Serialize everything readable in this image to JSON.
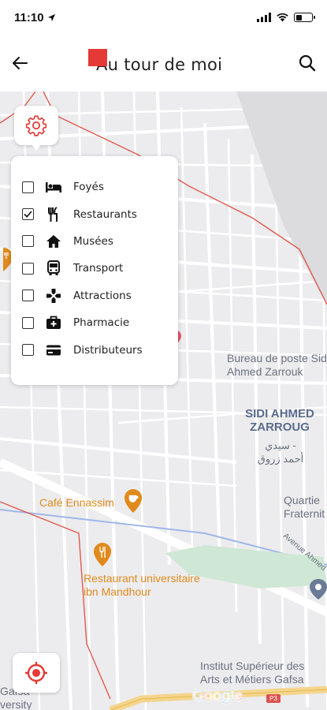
{
  "status_bar": {
    "time": "11:10",
    "icons": [
      "location-arrow-icon",
      "cellular-signal-icon",
      "wifi-icon",
      "battery-icon"
    ]
  },
  "header": {
    "title": "Au tour de moi",
    "back_icon": "arrow-left-icon",
    "search_icon": "search-icon"
  },
  "settings": {
    "icon": "gear-icon"
  },
  "filters": [
    {
      "label": "Foyés",
      "icon": "bed-icon",
      "checked": false
    },
    {
      "label": "Restaurants",
      "icon": "fork-knife-icon",
      "checked": true
    },
    {
      "label": "Musées",
      "icon": "home-icon",
      "checked": false
    },
    {
      "label": "Transport",
      "icon": "bus-icon",
      "checked": false
    },
    {
      "label": "Attractions",
      "icon": "game-pad-icon",
      "checked": false
    },
    {
      "label": "Pharmacie",
      "icon": "medical-bag-icon",
      "checked": false
    },
    {
      "label": "Distributeurs",
      "icon": "credit-card-icon",
      "checked": false
    }
  ],
  "map": {
    "labels": {
      "post_office": "Bureau de poste Sidi\nAhmed Zarrouk",
      "district": "SIDI AHMED\nZARROUG",
      "district_ar": "سيدي -\nأحمد زروق",
      "cafe": "Café Ennassim",
      "restaurant_univ": "Restaurant universitaire\nibn Mandhour",
      "quartier": "Quartie\nFraternit",
      "avenue": "Avenue Ahmed",
      "institut": "Institut Supérieur des\nArts et Métiers Gafsa",
      "univ_partial": "Gafsa\nversity",
      "road_badge": "P3",
      "google": "Google"
    },
    "colors": {
      "boundary": "#e05a4e",
      "poi": "#e08a1d",
      "accent": "#e53935"
    }
  },
  "locate": {
    "icon": "target-location-icon"
  }
}
